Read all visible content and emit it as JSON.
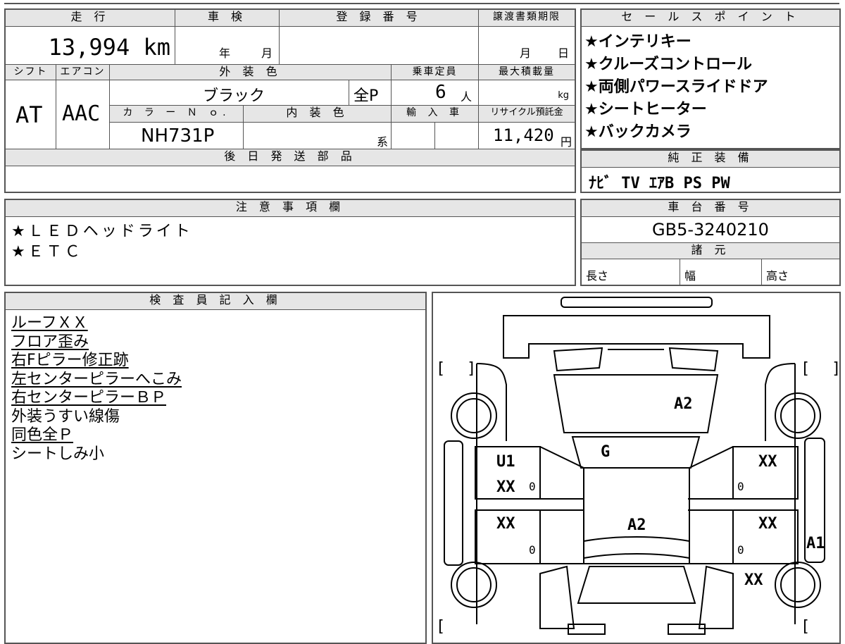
{
  "header": {
    "mileage_label": "走 行",
    "shaken_label": "車 検",
    "reg_label": "登 録 番 号",
    "transfer_label": "譲渡書類期限",
    "mileage_value": "13,994 km",
    "shaken_year": "年",
    "shaken_month": "月",
    "transfer_month": "月",
    "transfer_day": "日"
  },
  "row2": {
    "shift_label": "シフト",
    "ac_label": "エアコン",
    "ext_color_label": "外 装 色",
    "capacity_label": "乗車定員",
    "maxload_label": "最大積載量",
    "shift_value": "AT",
    "ac_value": "AAC",
    "ext_color_value": "ブラック",
    "paint_value": "全P",
    "capacity_value": "6",
    "capacity_unit": "人",
    "maxload_unit": "kg",
    "color_no_label": "カ ラ ー Ｎ ｏ.",
    "int_color_label": "内 装 色",
    "import_label": "輸 入 車",
    "recycle_label": "リサイクル預託金",
    "color_no_value": "NH731P",
    "int_color_unit": "系",
    "recycle_value": "11,420",
    "recycle_unit": "円"
  },
  "shipping": {
    "label": "後 日 発 送 部 品",
    "value": ""
  },
  "sales": {
    "label": "セ ー ル ス ポ イ ン ト",
    "points": [
      "★インテリキー",
      "★クルーズコントロール",
      "★両側パワースライドドア",
      "★シートヒーター",
      "★バックカメラ"
    ]
  },
  "equipment": {
    "label": "純 正 装 備",
    "value": "ﾅﾋﾞ TV ｴｱB PS PW"
  },
  "notes": {
    "label": "注 意 事 項 欄",
    "lines": [
      "★ＬＥＤヘッドライト",
      "★ＥＴＣ"
    ]
  },
  "chassis": {
    "label": "車 台 番 号",
    "value": "GB5-3240210"
  },
  "specs": {
    "label": "諸 元",
    "length": "長さ",
    "width": "幅",
    "height": "高さ"
  },
  "inspector": {
    "label": "検 査 員 記 入 欄",
    "lines": [
      {
        "text": "ルーフＸＸ",
        "underline": true
      },
      {
        "text": "フロア歪み",
        "underline": true
      },
      {
        "text": "右Fピラー修正跡",
        "underline": true
      },
      {
        "text": "左センターピラーへこみ",
        "underline": true
      },
      {
        "text": "右センターピラーＢＰ",
        "underline": true
      },
      {
        "text": "外装うすい線傷",
        "underline": false
      },
      {
        "text": "同色全Ｐ",
        "underline": true
      },
      {
        "text": "シートしみ小",
        "underline": false
      }
    ]
  },
  "diagram": {
    "marks": {
      "hood": "A2",
      "windshield": "G",
      "roof": "A2",
      "left_front_door": "U1",
      "left_front_door_2": "XX",
      "left_rear_door": "XX",
      "right_front_door": "XX",
      "right_rear_door": "XX",
      "right_rear_quarter": "XX",
      "right_side_panel": "A1",
      "zero_a": "0",
      "zero_b": "0",
      "zero_c": "0",
      "zero_d": "0"
    },
    "bracket_open": "[",
    "bracket_close": "]"
  }
}
